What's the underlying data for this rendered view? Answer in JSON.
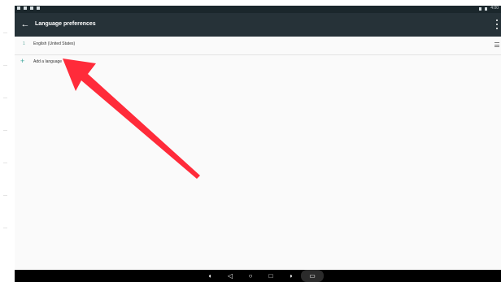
{
  "app": {
    "title": "Language preferences"
  },
  "status_bar": {
    "time": "4:00"
  },
  "languages": [
    {
      "number": "1",
      "name": "English (United States)"
    }
  ],
  "add_language": {
    "label": "Add a language"
  },
  "icons": {
    "back": "arrow-left-icon",
    "overflow": "more-vert-icon",
    "drag": "drag-handle-icon",
    "add": "plus-icon",
    "annotation": "red-arrow"
  },
  "colors": {
    "app_bar": "#263238",
    "status_bar": "#1b272c",
    "accent": "#3aa59a",
    "annotation_arrow": "#ff2b3a",
    "nav_bar": "#000000"
  }
}
